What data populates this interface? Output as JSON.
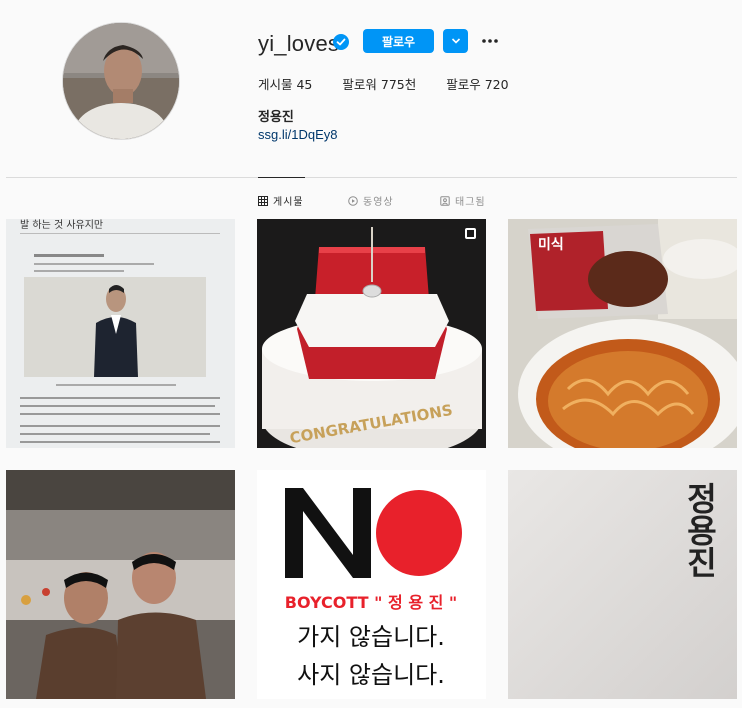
{
  "profile": {
    "username": "yi_loves",
    "follow_label": "팔로우",
    "full_name": "정용진",
    "link": "ssg.li/1DqEy8"
  },
  "stats": {
    "posts": "게시물 45",
    "followers": "팔로워 775천",
    "following": "팔로우 720"
  },
  "tabs": [
    {
      "label": "게시물",
      "icon": "grid-icon",
      "active": true
    },
    {
      "label": "동영상",
      "icon": "video-icon",
      "active": false
    },
    {
      "label": "태그됨",
      "icon": "tag-icon",
      "active": false
    }
  ],
  "posts": [
    {
      "alt": "news article photo",
      "text": "발 하는 것 사유지만"
    },
    {
      "alt": "cake with ring box",
      "text": "CONGRATULATIONS"
    },
    {
      "alt": "ramen bowl with noodle package",
      "text": "미식"
    },
    {
      "alt": "two men smiling in kitchen"
    },
    {
      "alt": "boycott poster",
      "no_text": "NO",
      "boycott": "BOYCOTT \" 정 용 진 \"",
      "line1": "가지 않습니다.",
      "line2": "사지 않습니다."
    },
    {
      "alt": "paper with vertical name",
      "text": "정용진"
    }
  ],
  "colors": {
    "accent": "#0095f6",
    "link": "#00376b",
    "boycott_red": "#e8212b"
  }
}
